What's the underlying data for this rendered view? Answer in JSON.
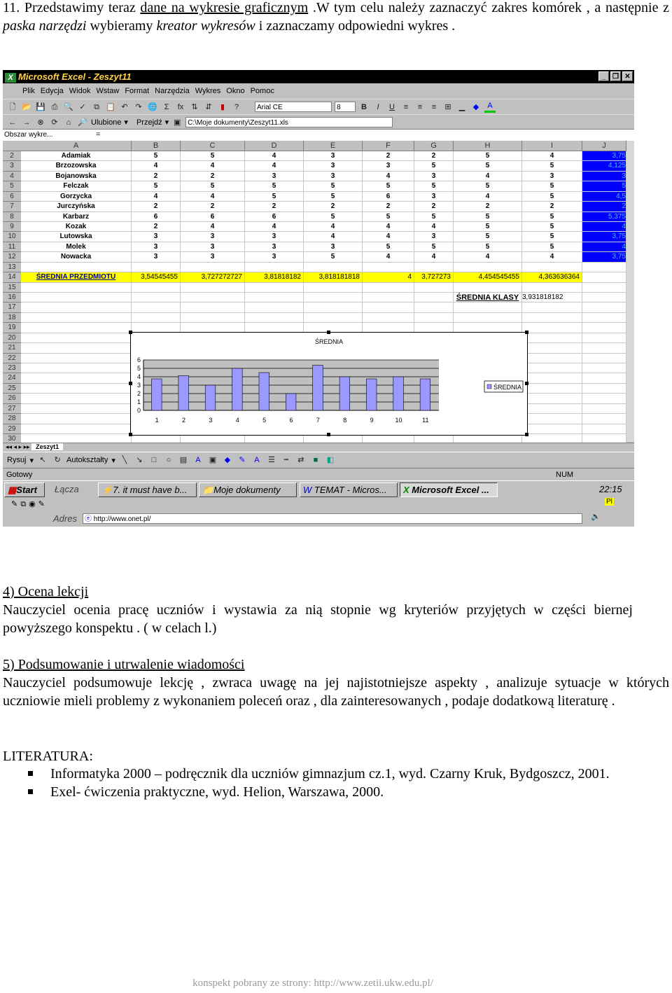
{
  "intro": {
    "num": "11. Przedstawimy teraz ",
    "u1": "dane na wykresie graficznym",
    "t1": " .W tym celu należy zaznaczyć zakres komórek , a następnie z ",
    "i1": "paska narzędzi",
    "t2": " wybieramy ",
    "i2": "kreator wykresów",
    "t3": " i zaznaczamy odpowiedni wykres ."
  },
  "excel": {
    "title": "Microsoft Excel - Zeszyt11",
    "menu": [
      "Plik",
      "Edycja",
      "Widok",
      "Wstaw",
      "Format",
      "Narzędzia",
      "Wykres",
      "Okno",
      "Pomoc"
    ],
    "font": "Arial CE",
    "font_size": "8",
    "favorites": "Ulubione",
    "go": "Przejdź",
    "path": "C:\\Moje dokumenty\\Zeszyt11.xls",
    "namebox": "Obszar wykre...",
    "equals": "=",
    "columns": [
      "A",
      "B",
      "C",
      "D",
      "E",
      "F",
      "G",
      "H",
      "I",
      "J"
    ],
    "rows": [
      {
        "n": "2",
        "c": [
          "Adamiak",
          "5",
          "5",
          "4",
          "3",
          "2",
          "2",
          "5",
          "4",
          "3,75"
        ]
      },
      {
        "n": "3",
        "c": [
          "Brzozowska",
          "4",
          "4",
          "4",
          "3",
          "3",
          "5",
          "5",
          "5",
          "4,125"
        ]
      },
      {
        "n": "4",
        "c": [
          "Bojanowska",
          "2",
          "2",
          "3",
          "3",
          "4",
          "3",
          "4",
          "3",
          "3"
        ]
      },
      {
        "n": "5",
        "c": [
          "Felczak",
          "5",
          "5",
          "5",
          "5",
          "5",
          "5",
          "5",
          "5",
          "5"
        ]
      },
      {
        "n": "6",
        "c": [
          "Gorzycka",
          "4",
          "4",
          "5",
          "5",
          "6",
          "3",
          "4",
          "5",
          "4,5"
        ]
      },
      {
        "n": "7",
        "c": [
          "Jurczyńska",
          "2",
          "2",
          "2",
          "2",
          "2",
          "2",
          "2",
          "2",
          "2"
        ]
      },
      {
        "n": "8",
        "c": [
          "Karbarz",
          "6",
          "6",
          "6",
          "5",
          "5",
          "5",
          "5",
          "5",
          "5,375"
        ]
      },
      {
        "n": "9",
        "c": [
          "Kozak",
          "2",
          "4",
          "4",
          "4",
          "4",
          "4",
          "5",
          "5",
          "4"
        ]
      },
      {
        "n": "10",
        "c": [
          "Lutowska",
          "3",
          "3",
          "3",
          "4",
          "4",
          "3",
          "5",
          "5",
          "3,75"
        ]
      },
      {
        "n": "11",
        "c": [
          "Molek",
          "3",
          "3",
          "3",
          "3",
          "5",
          "5",
          "5",
          "5",
          "4"
        ]
      },
      {
        "n": "12",
        "c": [
          "Nowacka",
          "3",
          "3",
          "3",
          "5",
          "4",
          "4",
          "4",
          "4",
          "3,75"
        ]
      },
      {
        "n": "13",
        "c": []
      },
      {
        "n": "14",
        "c": [
          "ŚREDNIA PRZEDMIOTU",
          "3,54545455",
          "3,727272727",
          "3,81818182",
          "3,818181818",
          "4",
          "3,727273",
          "4,454545455",
          "4,363636364",
          ""
        ]
      },
      {
        "n": "15",
        "c": []
      },
      {
        "n": "16",
        "c": [
          "",
          "",
          "",
          "",
          "",
          "",
          "",
          "ŚREDNIA KLASY",
          "3,931818182",
          ""
        ]
      },
      {
        "n": "17",
        "c": []
      },
      {
        "n": "18",
        "c": []
      },
      {
        "n": "19",
        "c": []
      },
      {
        "n": "20",
        "c": []
      },
      {
        "n": "21",
        "c": []
      },
      {
        "n": "22",
        "c": []
      },
      {
        "n": "23",
        "c": []
      },
      {
        "n": "24",
        "c": []
      },
      {
        "n": "25",
        "c": []
      },
      {
        "n": "26",
        "c": []
      },
      {
        "n": "27",
        "c": []
      },
      {
        "n": "28",
        "c": []
      },
      {
        "n": "29",
        "c": []
      },
      {
        "n": "30",
        "c": []
      }
    ],
    "sheet_tab": "Zeszyt1",
    "draw": "Rysuj",
    "autoshapes": "Autokształty",
    "status": "Gotowy",
    "num": "NUM",
    "taskbar": {
      "start": "Start",
      "links": "Łącza",
      "items": [
        "7. it must have b...",
        "Moje dokumenty",
        "TEMAT - Micros...",
        "Microsoft Excel ..."
      ],
      "clock": "22:15",
      "lang": "Pl",
      "address_label": "Adres",
      "address": "http://www.onet.pl/"
    },
    "colors": {
      "highlight": "#ffff00",
      "selection": "#0000ff",
      "bar": "#9999ff",
      "plot_bg": "#c0c0c0"
    }
  },
  "chart_data": {
    "type": "bar",
    "title": "ŚREDNIA",
    "categories": [
      "1",
      "2",
      "3",
      "4",
      "5",
      "6",
      "7",
      "8",
      "9",
      "10",
      "11"
    ],
    "series": [
      {
        "name": "ŚREDNIA",
        "values": [
          3.75,
          4.125,
          3,
          5,
          4.5,
          2,
          5.375,
          4,
          3.75,
          4,
          3.75
        ]
      }
    ],
    "yticks": [
      "0",
      "1",
      "2",
      "3",
      "4",
      "5",
      "6"
    ],
    "ylim": [
      0,
      6
    ],
    "grid": true,
    "legend": "right"
  },
  "s4": {
    "title": "4) Ocena lekcji",
    "body": "Nauczyciel ocenia pracę uczniów i wystawia za nią stopnie wg kryteriów przyjętych w części biernej powyższego konspektu . ( w celach l.)"
  },
  "s5": {
    "title": "5) Podsumowanie i utrwalenie wiadomości",
    "body": "Nauczyciel podsumowuje lekcję , zwraca uwagę na jej najistotniejsze aspekty , analizuje sytuacje w których uczniowie mieli problemy z wykonaniem poleceń oraz , dla zainteresowanych , podaje dodatkową literaturę ."
  },
  "lit": {
    "title": "LITERATURA:",
    "items": [
      "Informatyka 2000 – podręcznik dla uczniów gimnazjum cz.1, wyd. Czarny Kruk, Bydgoszcz, 2001.",
      "Exel- ćwiczenia praktyczne, wyd. Helion, Warszawa, 2000."
    ]
  },
  "footer": "konspekt pobrany ze strony: http://www.zetii.ukw.edu.pl/"
}
